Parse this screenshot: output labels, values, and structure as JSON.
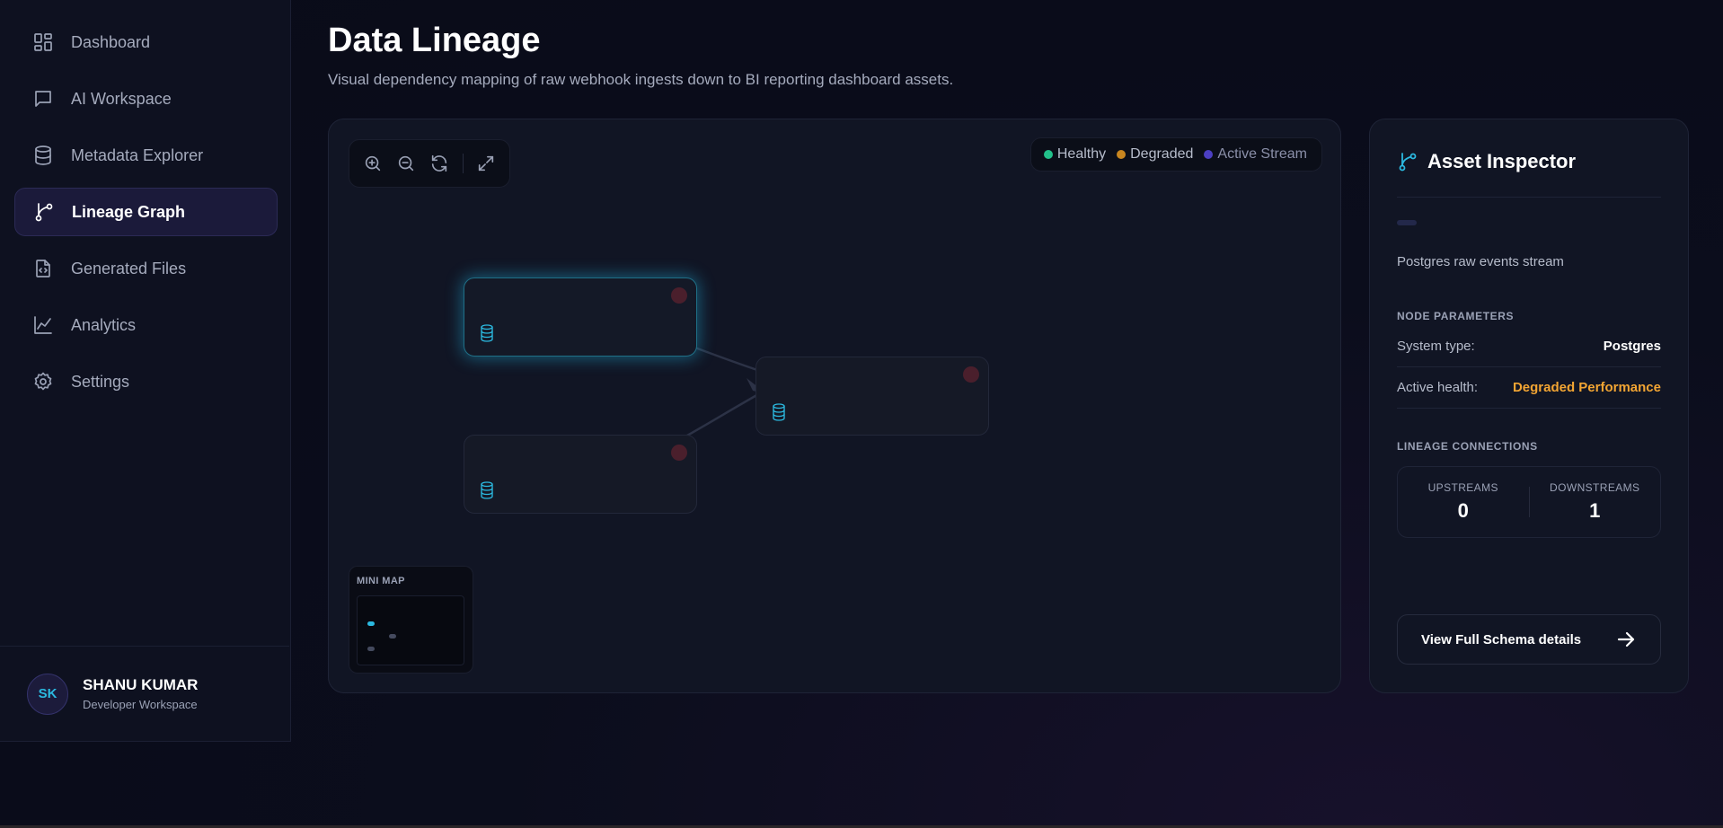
{
  "sidebar": {
    "items": [
      {
        "label": "Dashboard",
        "icon": "dashboard-icon"
      },
      {
        "label": "AI Workspace",
        "icon": "chat-icon"
      },
      {
        "label": "Metadata Explorer",
        "icon": "database-icon"
      },
      {
        "label": "Lineage Graph",
        "icon": "lineage-icon",
        "active": true
      },
      {
        "label": "Generated Files",
        "icon": "code-file-icon"
      },
      {
        "label": "Analytics",
        "icon": "chart-icon"
      },
      {
        "label": "Settings",
        "icon": "gear-icon"
      }
    ],
    "profile": {
      "initials": "SK",
      "name": "SHANU KUMAR",
      "subtitle": "Developer Workspace"
    }
  },
  "header": {
    "title": "Data Lineage",
    "subtitle": "Visual dependency mapping of raw webhook ingests down to BI reporting dashboard assets."
  },
  "canvas": {
    "toolbar": [
      "zoom-in-icon",
      "zoom-out-icon",
      "refresh-icon",
      "fullscreen-icon"
    ],
    "legend": [
      {
        "label": "Healthy",
        "color": "#22c08a"
      },
      {
        "label": "Degraded",
        "color": "#c9861f"
      },
      {
        "label": "Active Stream",
        "color": "#4c3fc2"
      }
    ],
    "minimap_title": "MINI MAP"
  },
  "inspector": {
    "title": "Asset Inspector",
    "description": "Postgres raw events stream",
    "node_parameters_title": "NODE PARAMETERS",
    "system_type_label": "System type:",
    "system_type_value": "Postgres",
    "health_label": "Active health:",
    "health_value": "Degraded Performance",
    "connections_title": "LINEAGE CONNECTIONS",
    "upstreams_label": "UPSTREAMS",
    "upstreams_value": "0",
    "downstreams_label": "DOWNSTREAMS",
    "downstreams_value": "1",
    "view_button": "View Full Schema details"
  },
  "colors": {
    "accent": "#2bb9e0",
    "warning": "#f3a533",
    "active_nav": "#1b1a3a"
  }
}
